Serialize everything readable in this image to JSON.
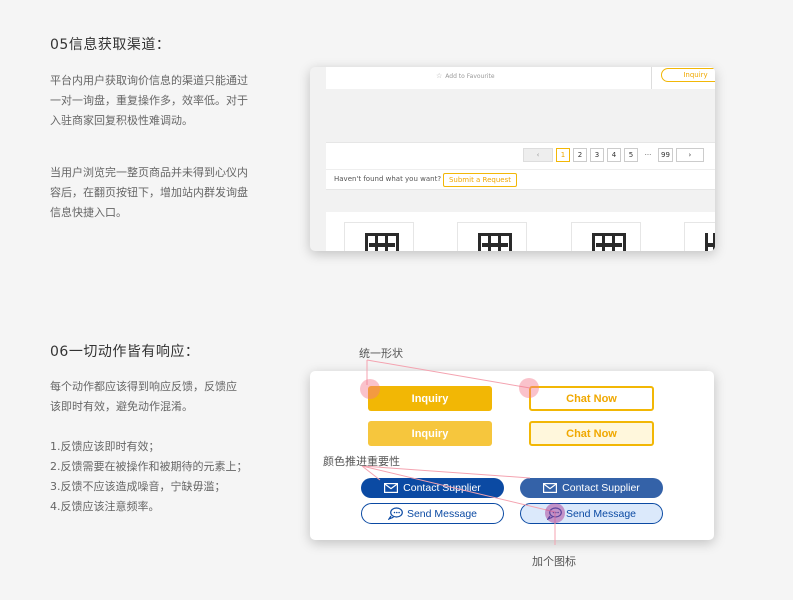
{
  "section05": {
    "title": "05信息获取渠道：",
    "para1_lines": [
      "平台内用户获取询价信息的渠道只能通过",
      "一对一询盘，重复操作多，效率低。对于",
      "入驻商家回复积极性难调动。"
    ],
    "para2_lines": [
      "当用户浏览完一整页商品并未得到心仪内",
      "容后，在翻页按钮下，增加站内群发询盘",
      "信息快捷入口。"
    ],
    "screenshot": {
      "favourite_label": "Add to Favourite",
      "inquiry_label": "Inquiry",
      "pages": [
        "1",
        "2",
        "3",
        "4",
        "5",
        "···",
        "99"
      ],
      "active_page": "1",
      "found_text": "Haven't found what you want?",
      "submit_label": "Submit a Request"
    }
  },
  "section06": {
    "title": "06一切动作皆有响应：",
    "para1_lines": [
      "每个动作都应该得到响应反馈，反馈应",
      "该即时有效，避免动作混淆。"
    ],
    "list": [
      "1.反馈应该即时有效；",
      "2.反馈需要在被操作和被期待的元素上；",
      "3.反馈不应该造成噪音，宁缺毋滥；",
      "4.反馈应该注意频率。"
    ],
    "buttons": {
      "inquiry": "Inquiry",
      "chat_now": "Chat Now",
      "contact_supplier": "Contact Supplier",
      "send_message": "Send Message"
    },
    "annotations": {
      "shape": "统一形状",
      "color": "颜色推进重要性",
      "icon": "加个图标"
    }
  },
  "colors": {
    "yellow": "#f2b705",
    "yellow_light": "#f6c63d",
    "blue": "#0b4aa3",
    "blue_light": "#3462a8",
    "annotation_dot": "#f5788c"
  }
}
